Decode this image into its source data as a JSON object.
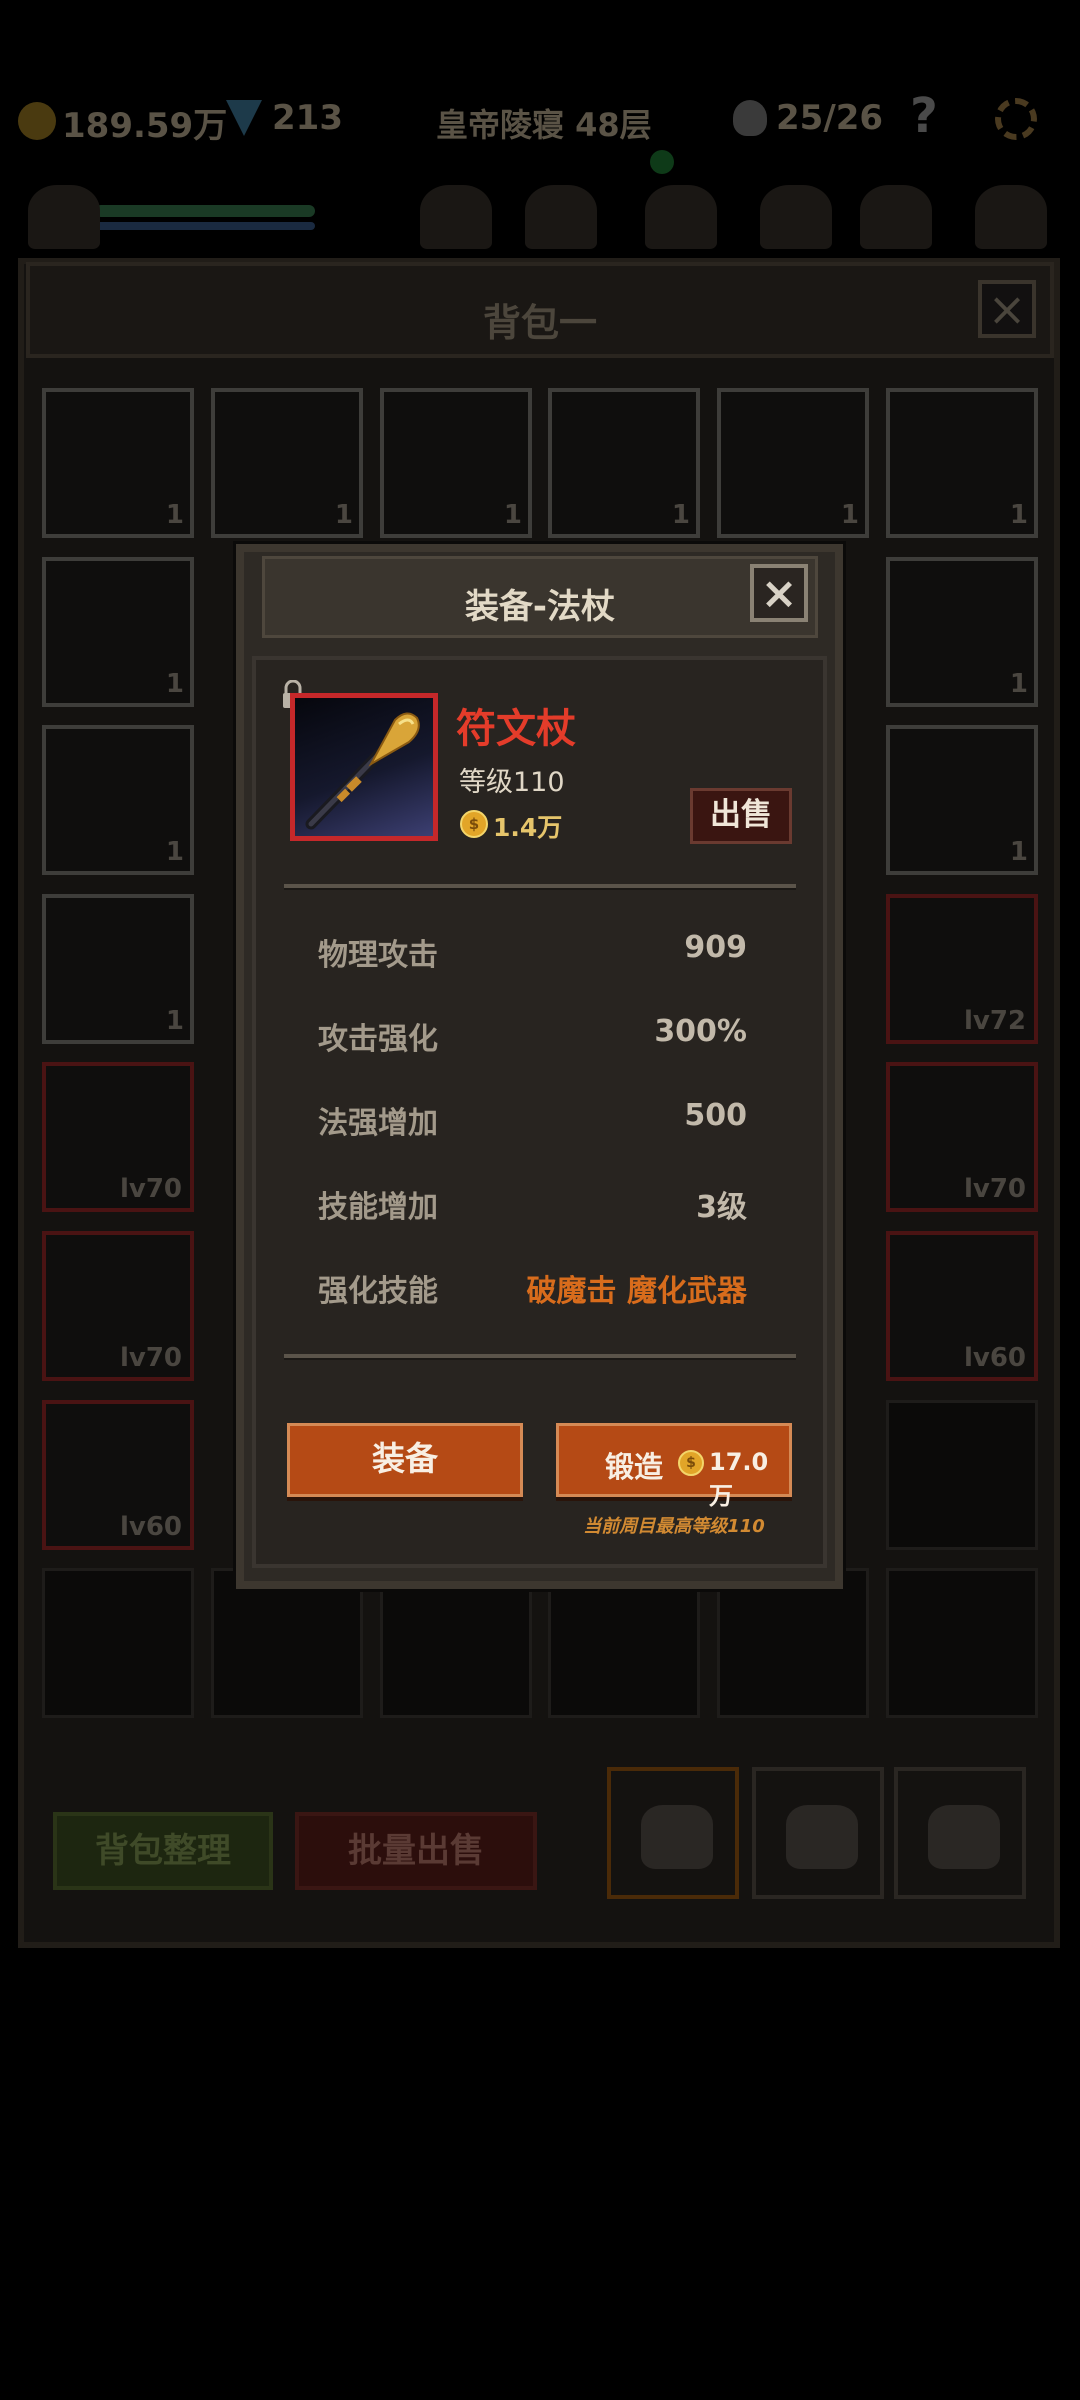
{
  "topbar": {
    "gold": "189.59万",
    "gems": "213",
    "location": "皇帝陵寝 48层",
    "kills": "25/26",
    "help": "?"
  },
  "bag": {
    "title": "背包一",
    "close": "×",
    "slots_row1": [
      "1",
      "1",
      "1",
      "1",
      "1",
      "1"
    ],
    "slots_row2": [
      "1",
      "1"
    ],
    "slots_row3": [
      "1",
      "1"
    ],
    "slots_row4": [
      "1",
      "lv72"
    ],
    "slots_row5": [
      "lv70",
      "lv70"
    ],
    "slots_row6": [
      "lv70",
      "lv60"
    ],
    "slots_row7": [
      "lv60"
    ],
    "sort_button": "背包整理",
    "bulk_sell_button": "批量出售"
  },
  "modal": {
    "title": "装备-法杖",
    "close": "×",
    "item": {
      "name": "符文杖",
      "level": "等级110",
      "price": "1.4万",
      "coin_symbol": "$",
      "sell_button": "出售",
      "frame_color": "#c5282a"
    },
    "stats": [
      {
        "label": "物理攻击",
        "value": "909"
      },
      {
        "label": "攻击强化",
        "value": "300%"
      },
      {
        "label": "法强增加",
        "value": "500"
      },
      {
        "label": "技能增加",
        "value": "3级"
      },
      {
        "label": "强化技能",
        "value": "破魔击 魔化武器"
      }
    ],
    "equip_button": "装备",
    "forge_button": "锻造",
    "forge_cost": "17.0万",
    "max_level_note": "当前周目最高等级110"
  },
  "colors": {
    "accent_orange": "#b54a15",
    "item_name_red": "#e43c2a",
    "skill_orange": "#d86c1c"
  }
}
